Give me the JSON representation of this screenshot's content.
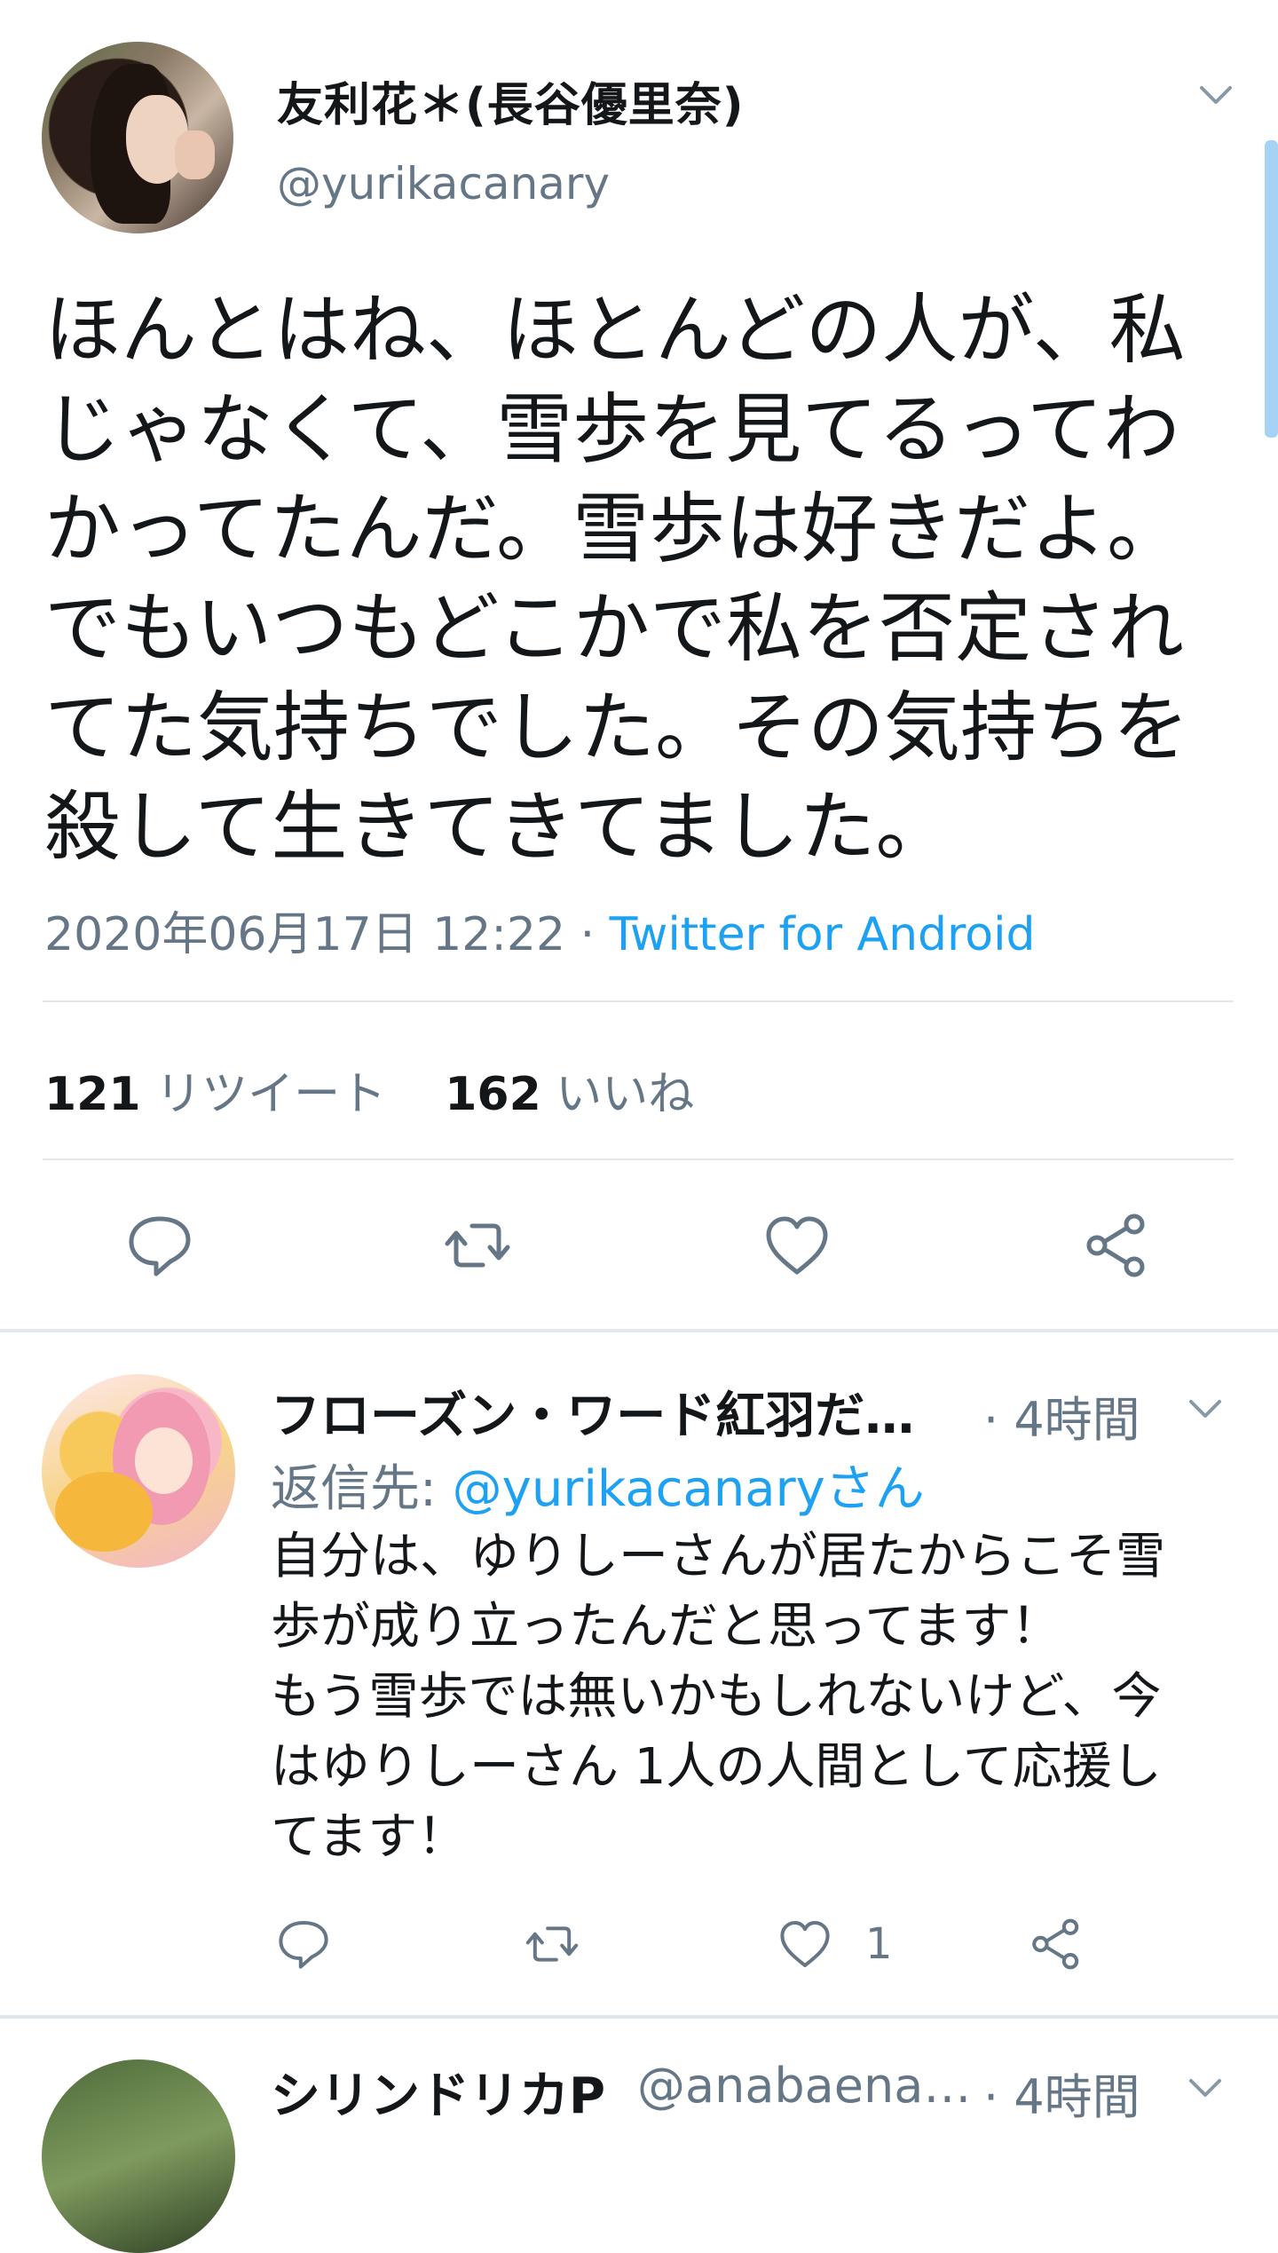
{
  "main_tweet": {
    "display_name": "友利花＊(長谷優里奈)",
    "handle": "@yurikacanary",
    "body": "ほんとはね、ほとんどの人が、私\nじゃなくて、雪歩を見てるってわ\nかってたんだ。雪歩は好きだよ。\nでもいつもどこかで私を否定され\nてた気持ちでした。その気持ちを\n殺して生きてきてました。",
    "timestamp": "2020年06月17日 12:22",
    "separator": " · ",
    "source": "Twitter for Android",
    "retweet_count": "121",
    "retweet_label": "リツイート",
    "like_count": "162",
    "like_label": "いいね"
  },
  "reply": {
    "display_name": "フローズン・ワード紅羽だ…",
    "time": "· 4時間",
    "reply_to_label": "返信先: ",
    "reply_to_mention": "@yurikacanaryさん",
    "body": "自分は、ゆりしーさんが居たからこそ雪\n歩が成り立ったんだと思ってます！\nもう雪歩では無いかもしれないけど、今\nはゆりしーさん 1人の人間として応援し\nてます！",
    "like_count": "1"
  },
  "next_reply": {
    "display_name": "シリンドリカP",
    "handle": "@anabaena…",
    "time": "· 4時間"
  },
  "icons": [
    "chevron-down-icon",
    "reply-icon",
    "retweet-icon",
    "like-icon",
    "share-icon"
  ],
  "colors": {
    "text": "#14171a",
    "secondary": "#657786",
    "link": "#1da1f2",
    "divider": "#e1e8ed",
    "scrollbar": "#a6d3f5"
  }
}
